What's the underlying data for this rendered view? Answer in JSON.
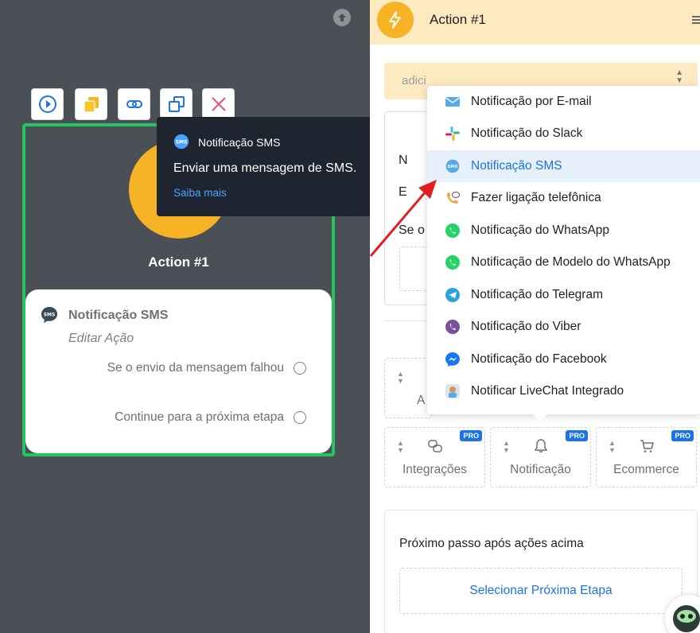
{
  "canvas": {
    "node_title": "Action #1",
    "card": {
      "title": "Notificação SMS",
      "subtitle": "Editar Ação",
      "options": [
        "Se o envio da mensagem falhou",
        "Continue para a próxima etapa"
      ]
    },
    "toolbar": [
      "play-icon",
      "copy-icon",
      "link-icon",
      "duplicate-icon",
      "close-icon"
    ]
  },
  "tooltip": {
    "title": "Notificação SMS",
    "description": "Enviar uma mensagem de SMS.",
    "link": "Saiba mais"
  },
  "panel": {
    "header_title": "Action #1",
    "select_placeholder": "adici",
    "hidden_letters": [
      "N",
      "E",
      "Se o",
      "A"
    ],
    "tiles": [
      {
        "label": "Integrações",
        "badge": "PRO",
        "icon": "integrations-icon"
      },
      {
        "label": "Notificação",
        "badge": "PRO",
        "icon": "bell-icon"
      },
      {
        "label": "Ecommerce",
        "badge": "PRO",
        "icon": "cart-icon"
      }
    ],
    "next_step_label": "Próximo passo após ações acima",
    "next_step_button": "Selecionar Próxima Etapa"
  },
  "dropdown": {
    "items": [
      {
        "label": "Notificação por E-mail",
        "icon": "email-icon"
      },
      {
        "label": "Notificação do Slack",
        "icon": "slack-icon"
      },
      {
        "label": "Notificação SMS",
        "icon": "sms-icon",
        "selected": true
      },
      {
        "label": "Fazer ligação telefônica",
        "icon": "phone-icon"
      },
      {
        "label": "Notificação do WhatsApp",
        "icon": "whatsapp-icon"
      },
      {
        "label": "Notificação de Modelo do WhatsApp",
        "icon": "whatsapp-icon"
      },
      {
        "label": "Notificação do Telegram",
        "icon": "telegram-icon"
      },
      {
        "label": "Notificação do Viber",
        "icon": "viber-icon"
      },
      {
        "label": "Notificação do Facebook",
        "icon": "messenger-icon"
      },
      {
        "label": "Notificar LiveChat Integrado",
        "icon": "livechat-icon"
      }
    ]
  },
  "colors": {
    "node_border": "#22c55e",
    "accent_yellow": "#f5b325",
    "header_bg": "#fdeac0",
    "link_blue": "#1a73e8",
    "arrow_red": "#e02020"
  }
}
